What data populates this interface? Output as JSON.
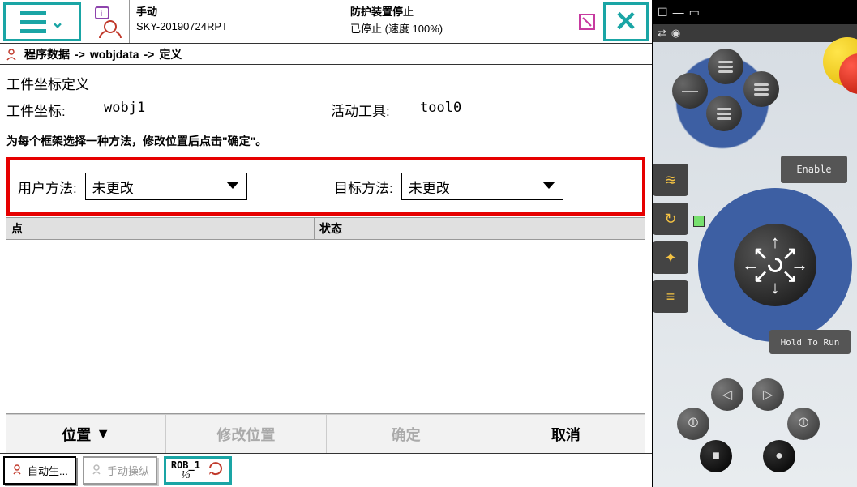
{
  "header": {
    "mode_label": "手动",
    "system_id": "SKY-20190724RPT",
    "guard_label": "防护装置停止",
    "status_line": "已停止 (速度 100%)"
  },
  "breadcrumb": {
    "item1": "程序数据",
    "arrow": "->",
    "item2": "wobjdata",
    "item3": "定义"
  },
  "content": {
    "title": "工件坐标定义",
    "coord_label": "工件坐标:",
    "coord_value": "wobj1",
    "tool_label": "活动工具:",
    "tool_value": "tool0",
    "hint": "为每个框架选择一种方法，修改位置后点击\"确定\"。",
    "user_method_label": "用户方法:",
    "user_method_value": "未更改",
    "target_method_label": "目标方法:",
    "target_method_value": "未更改"
  },
  "table": {
    "col_point": "点",
    "col_state": "状态"
  },
  "buttons": {
    "position": "位置",
    "modify": "修改位置",
    "ok": "确定",
    "cancel": "取消"
  },
  "status": {
    "chip1": "自动生...",
    "chip2": "手动操纵",
    "rob": "ROB_1",
    "frac": "⅓"
  },
  "controller": {
    "enable": "Enable",
    "hold": "Hold To Run"
  }
}
